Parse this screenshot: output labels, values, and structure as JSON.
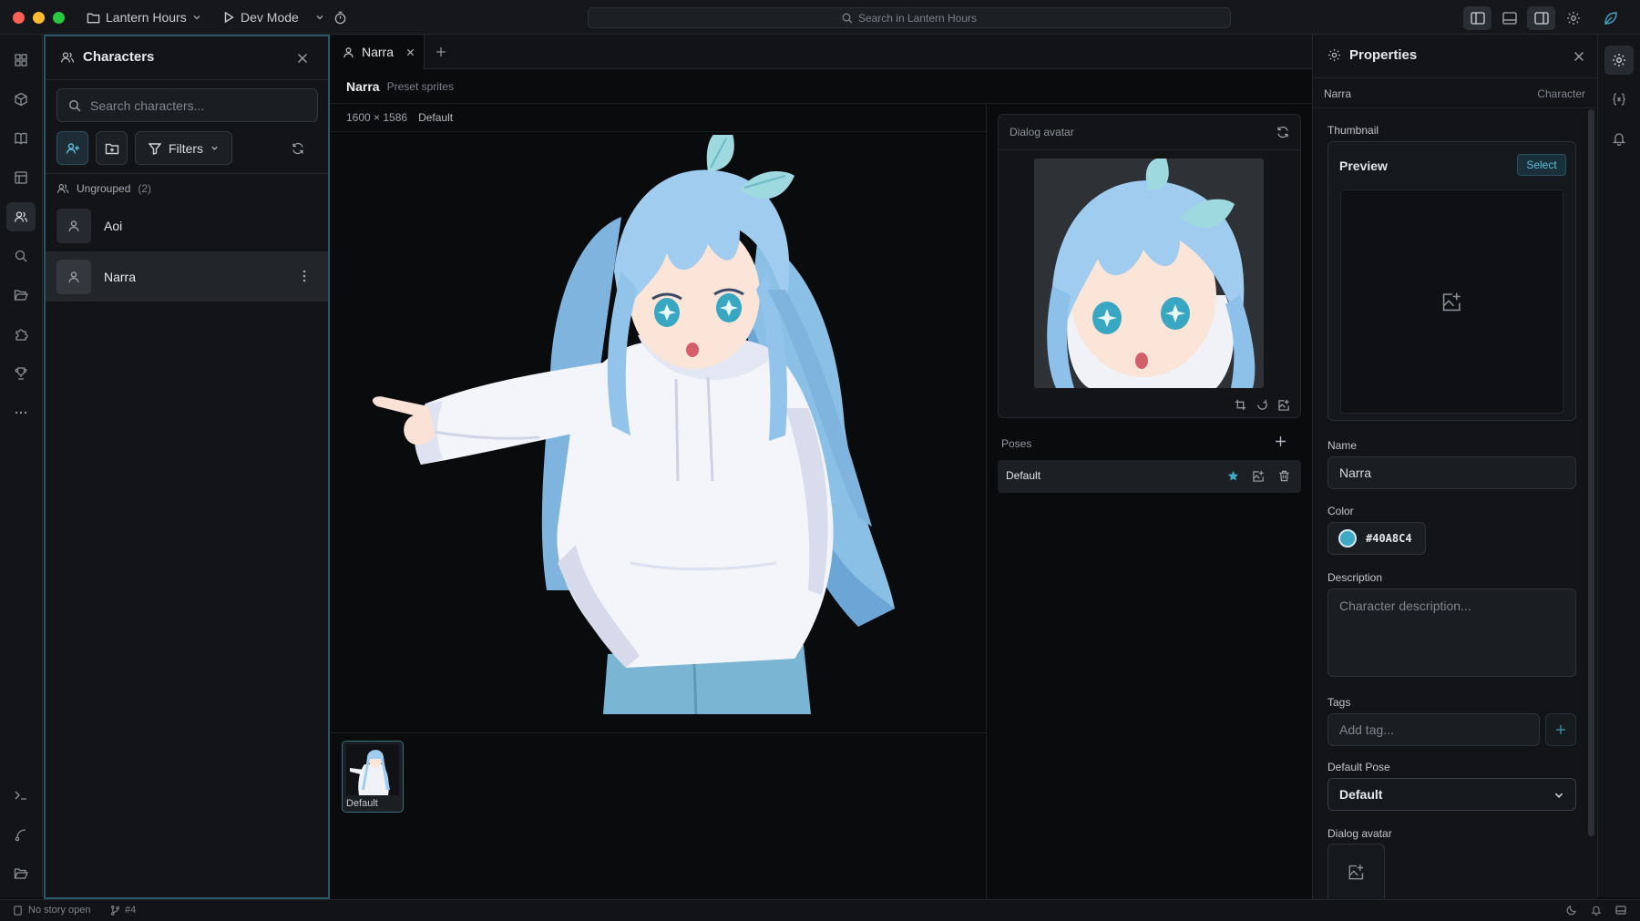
{
  "window": {
    "project": "Lantern Hours",
    "mode": "Dev Mode",
    "search_placeholder": "Search in Lantern Hours"
  },
  "characters_panel": {
    "title": "Characters",
    "search_placeholder": "Search characters...",
    "filters_label": "Filters",
    "group": {
      "label": "Ungrouped",
      "count": "(2)"
    },
    "items": [
      {
        "name": "Aoi"
      },
      {
        "name": "Narra"
      }
    ]
  },
  "editor": {
    "tab_label": "Narra",
    "title": "Narra",
    "subtitle": "Preset sprites",
    "dimensions": "1600 × 1586",
    "pose_label": "Default",
    "thumbnail_label": "Default"
  },
  "dialog_avatar_card": {
    "title": "Dialog avatar"
  },
  "poses": {
    "title": "Poses",
    "items": [
      {
        "name": "Default"
      }
    ]
  },
  "properties": {
    "title": "Properties",
    "entity_name": "Narra",
    "entity_type": "Character",
    "thumbnail_label": "Thumbnail",
    "preview_label": "Preview",
    "select_label": "Select",
    "name_label": "Name",
    "name_value": "Narra",
    "color_label": "Color",
    "color_value": "#40A8C4",
    "description_label": "Description",
    "description_placeholder": "Character description...",
    "tags_label": "Tags",
    "tags_placeholder": "Add tag...",
    "default_pose_label": "Default Pose",
    "default_pose_value": "Default",
    "dialog_avatar_label": "Dialog avatar"
  },
  "status_bar": {
    "story_status": "No story open",
    "branch": "#4"
  },
  "colors": {
    "accent": "#40A8C4",
    "panel_border": "#2a5866",
    "background": "#0a0b0d",
    "hair": "#9fcdef",
    "hoodie": "#f4f5fb"
  },
  "icons": [
    "folder-icon",
    "play-icon",
    "timer-icon",
    "search-icon",
    "layout-left-icon",
    "layout-bottom-icon",
    "layout-right-icon",
    "gear-icon",
    "leaf-icon",
    "dashboard-icon",
    "cube-icon",
    "book-icon",
    "layout-icon",
    "users-icon",
    "folder-open-icon",
    "puzzle-icon",
    "trophy-icon",
    "more-icon",
    "terminal-icon",
    "branch-icon",
    "add-user-icon",
    "add-folder-icon",
    "filter-icon",
    "refresh-icon",
    "close-icon",
    "plus-icon",
    "crop-icon",
    "rotate-icon",
    "image-plus-icon",
    "star-icon",
    "trash-icon",
    "braces-icon",
    "bell-icon",
    "moon-icon",
    "chevron-down-icon"
  ]
}
